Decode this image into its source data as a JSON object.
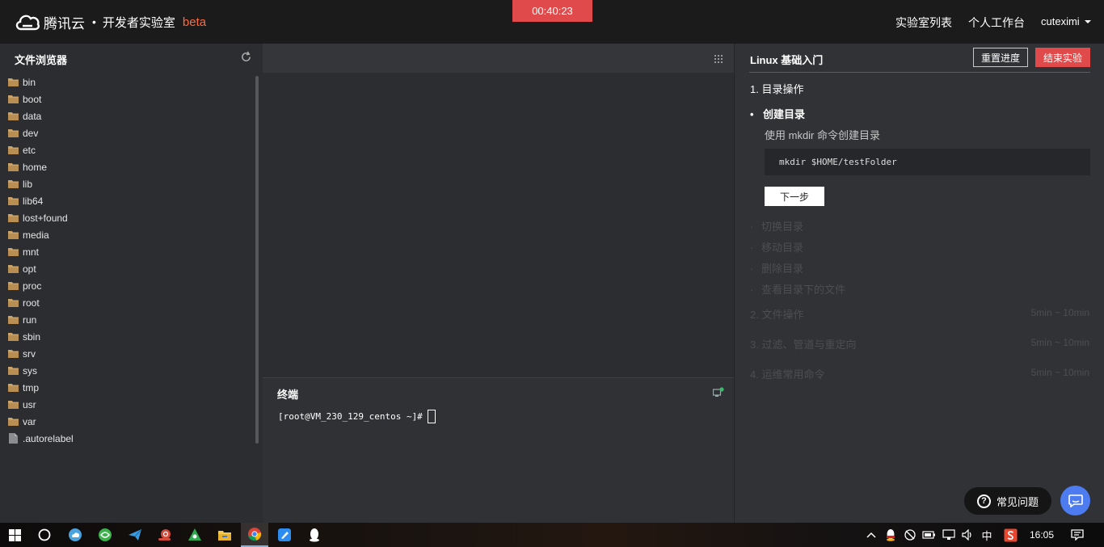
{
  "header": {
    "brand": "腾讯云",
    "separator": "•",
    "lab_title": "开发者实验室",
    "beta": "beta",
    "timer": "00:40:23",
    "nav": [
      "实验室列表",
      "个人工作台"
    ],
    "user": "cuteximi"
  },
  "file_browser": {
    "title": "文件浏览器",
    "items": [
      {
        "name": "bin",
        "type": "folder"
      },
      {
        "name": "boot",
        "type": "folder"
      },
      {
        "name": "data",
        "type": "folder"
      },
      {
        "name": "dev",
        "type": "folder"
      },
      {
        "name": "etc",
        "type": "folder"
      },
      {
        "name": "home",
        "type": "folder"
      },
      {
        "name": "lib",
        "type": "folder"
      },
      {
        "name": "lib64",
        "type": "folder"
      },
      {
        "name": "lost+found",
        "type": "folder"
      },
      {
        "name": "media",
        "type": "folder"
      },
      {
        "name": "mnt",
        "type": "folder"
      },
      {
        "name": "opt",
        "type": "folder"
      },
      {
        "name": "proc",
        "type": "folder"
      },
      {
        "name": "root",
        "type": "folder"
      },
      {
        "name": "run",
        "type": "folder"
      },
      {
        "name": "sbin",
        "type": "folder"
      },
      {
        "name": "srv",
        "type": "folder"
      },
      {
        "name": "sys",
        "type": "folder"
      },
      {
        "name": "tmp",
        "type": "folder"
      },
      {
        "name": "usr",
        "type": "folder"
      },
      {
        "name": "var",
        "type": "folder"
      },
      {
        "name": ".autorelabel",
        "type": "file"
      }
    ]
  },
  "terminal": {
    "title": "终端",
    "prompt": "[root@VM_230_129_centos ~]#"
  },
  "guide": {
    "title": "Linux 基础入门",
    "reset_label": "重置进度",
    "end_label": "结束实验",
    "section1": "1. 目录操作",
    "current_step": {
      "bullet": "•",
      "label": "创建目录",
      "description": "使用 mkdir 命令创建目录",
      "code": "mkdir $HOME/testFolder",
      "next_label": "下一步"
    },
    "pending_steps": [
      "切换目录",
      "移动目录",
      "删除目录",
      "查看目录下的文件"
    ],
    "sections": [
      {
        "label": "2. 文件操作",
        "duration": "5min ~ 10min"
      },
      {
        "label": "3. 过滤、管道与重定向",
        "duration": "5min ~ 10min"
      },
      {
        "label": "4. 运维常用命令",
        "duration": "5min ~ 10min"
      }
    ]
  },
  "support": {
    "faq_label": "常见问题"
  },
  "taskbar": {
    "ime": "中",
    "clock": "16:05"
  },
  "colors": {
    "accent_red": "#e04a4a",
    "beta_orange": "#ff6a3d",
    "chat_blue": "#4d7cf0"
  }
}
